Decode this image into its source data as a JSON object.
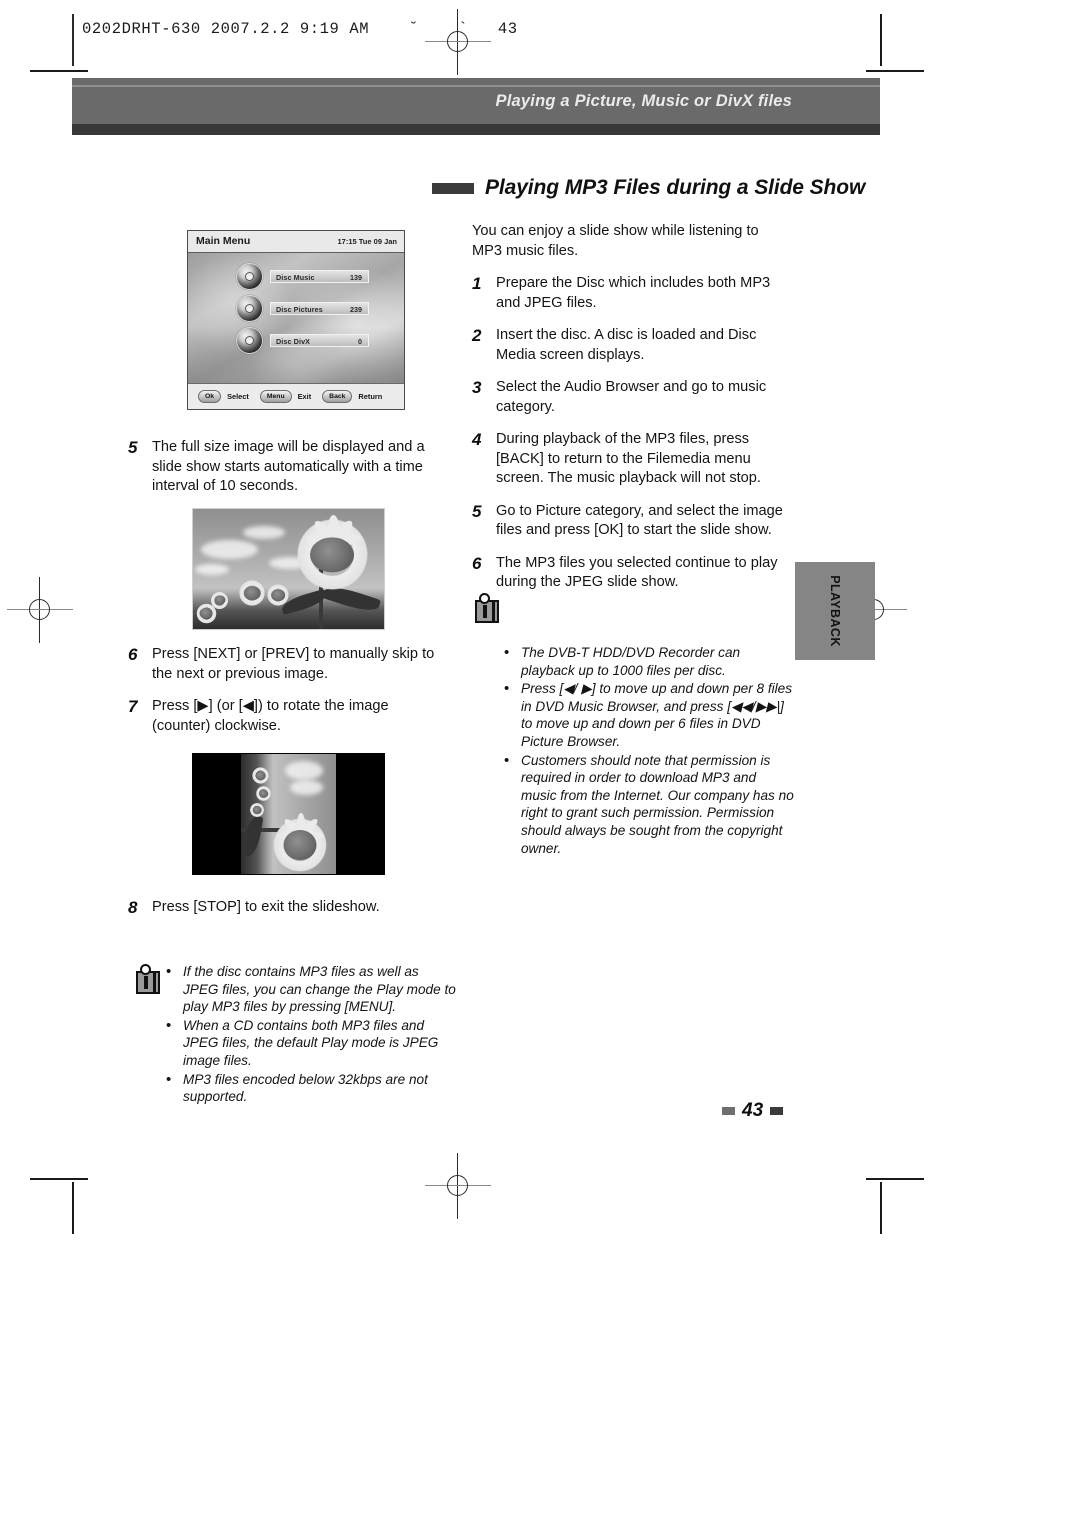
{
  "print_marks": {
    "slug": "0202DRHT-630 2007.2.2 9:19 AM    ˘    `   43"
  },
  "header": {
    "band_title": "Playing a Picture, Music or DivX files"
  },
  "section": {
    "title": "Playing MP3 Files during a Slide Show"
  },
  "tv_screenshot": {
    "title": "Main Menu",
    "clock": "17:15 Tue 09 Jan",
    "menu_items": [
      {
        "label": "Disc Music",
        "count": "139",
        "icon": "disc-music-icon"
      },
      {
        "label": "Disc Pictures",
        "count": "239",
        "icon": "disc-pictures-icon"
      },
      {
        "label": "Disc DivX",
        "count": "0",
        "icon": "disc-divx-icon"
      }
    ],
    "footer_keys": [
      {
        "key": "Ok",
        "action": "Select"
      },
      {
        "key": "Menu",
        "action": "Exit"
      },
      {
        "key": "Back",
        "action": "Return"
      }
    ]
  },
  "right_column": {
    "intro": "You can enjoy a slide show while listening to MP3 music files.",
    "steps": [
      {
        "num": "1",
        "text": "Prepare the Disc which includes both MP3 and JPEG files."
      },
      {
        "num": "2",
        "text": "Insert the disc. A disc is loaded and Disc Media screen displays."
      },
      {
        "num": "3",
        "text": "Select the Audio Browser and go to music category."
      },
      {
        "num": "4",
        "text": "During playback of the MP3 files, press [BACK] to return to the Filemedia menu screen. The music playback will not stop."
      },
      {
        "num": "5",
        "text": "Go to Picture category, and select the image files and press [OK] to start the slide show."
      },
      {
        "num": "6",
        "text": "The MP3 files you selected continue to play during the JPEG slide show."
      }
    ],
    "note": {
      "icon": "info-note-icon",
      "bullet_char": "•",
      "bullets": [
        "The DVB-T HDD/DVD Recorder can playback up to 1000 files per disc.",
        "Press [◀/ ▶] to move up and down per 8 files in DVD Music Browser, and press [◀◀/▶▶|] to move up and down per 6 files in DVD Picture Browser.",
        "Customers should note that permission is required in order to download MP3  and music from the Internet. Our company has no right to grant such permission. Permission should always be sought from the copyright owner."
      ]
    }
  },
  "left_column": {
    "steps": [
      {
        "num": "5",
        "text": "The full size image will be displayed and a slide show starts automatically with a time interval of 10 seconds."
      },
      {
        "num": "6",
        "text": "Press [NEXT] or [PREV] to manually skip to the next or previous image."
      },
      {
        "num": "7",
        "text": "Press [▶] (or [◀]) to rotate the image (counter) clockwise."
      },
      {
        "num": "8",
        "text": "Press [STOP] to exit the slideshow."
      }
    ],
    "note": {
      "icon": "info-note-icon",
      "bullet_char": "•",
      "bullets": [
        "If the disc contains MP3 files as well as JPEG files, you can change the Play mode to play MP3 files by pressing [MENU].",
        "When a CD contains both MP3 files and JPEG files, the default Play mode is JPEG image files.",
        "MP3 files encoded below 32kbps are not supported."
      ]
    }
  },
  "side_tab": {
    "label": "PLAYBACK"
  },
  "footer": {
    "page_number": "43"
  },
  "photos": [
    {
      "name": "sunflower-photo",
      "caption_alt": "sunflower field full size image"
    },
    {
      "name": "sunflower-rotated-photo",
      "caption_alt": "rotated sunflower image with black bars"
    }
  ],
  "colors": {
    "header_band": "#6a6a6a",
    "header_underbar": "#383838",
    "side_tab": "#858585",
    "text": "#141414"
  }
}
